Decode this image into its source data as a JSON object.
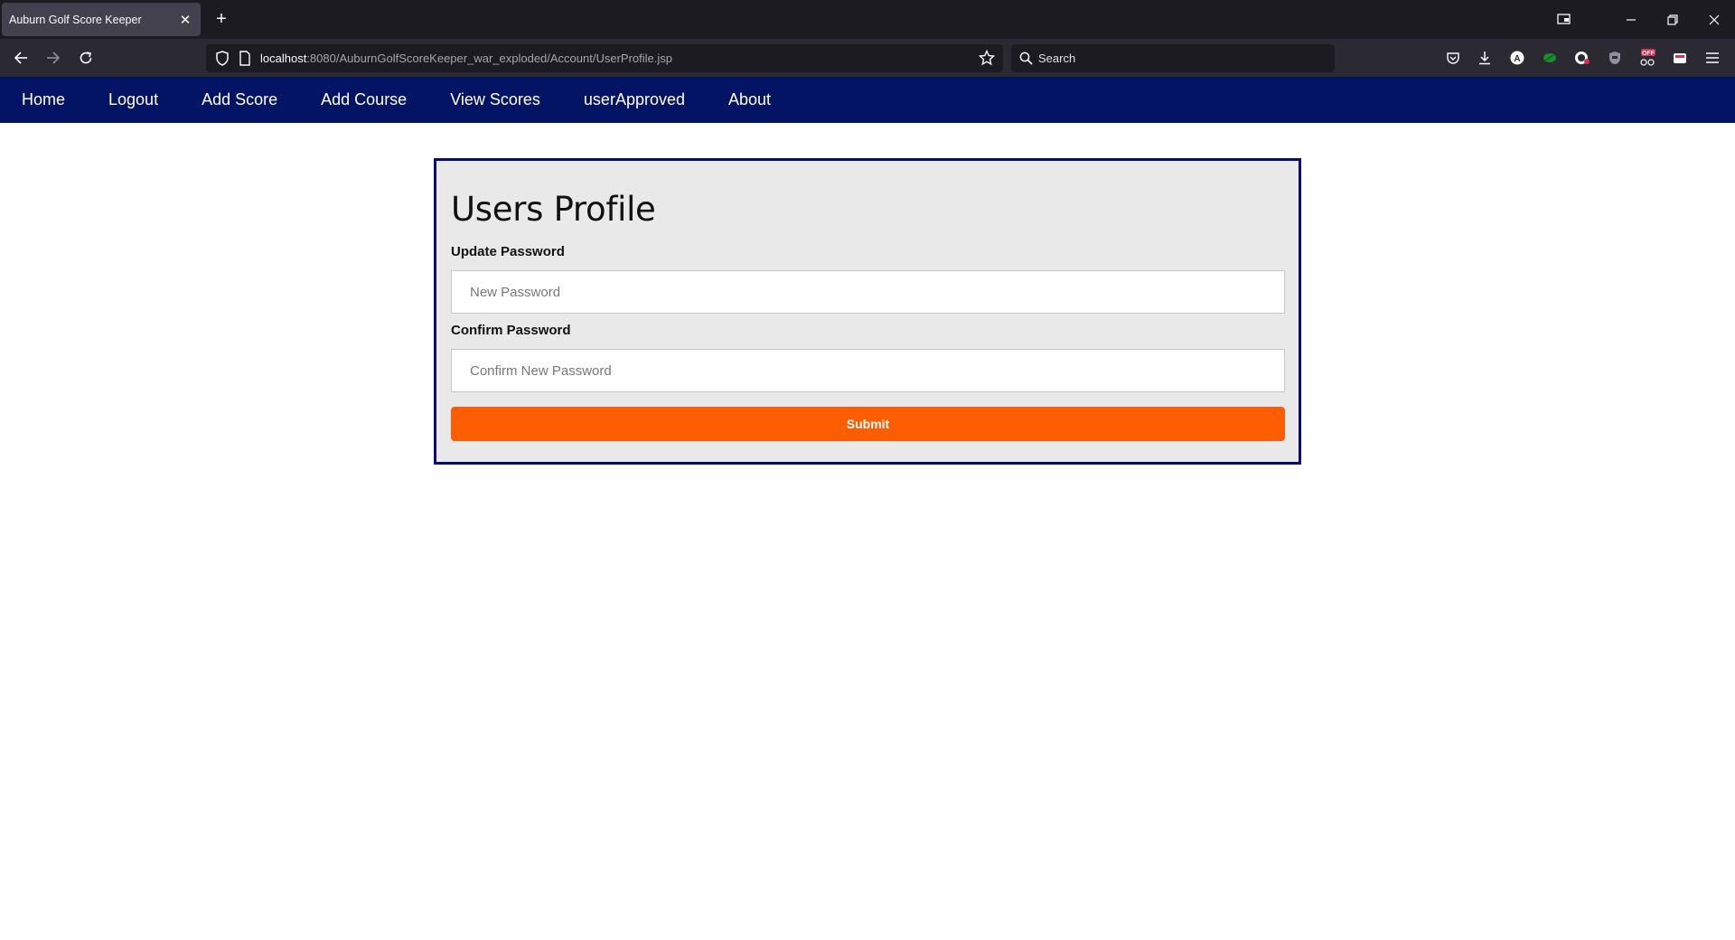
{
  "browser": {
    "tab_title": "Auburn Golf Score Keeper",
    "url_host": "localhost",
    "url_rest": ":8080/AuburnGolfScoreKeeper_war_exploded/Account/UserProfile.jsp",
    "search_placeholder": "Search",
    "ext_badge": "OFF"
  },
  "nav": {
    "items": [
      {
        "label": "Home"
      },
      {
        "label": "Logout"
      },
      {
        "label": "Add Score"
      },
      {
        "label": "Add Course"
      },
      {
        "label": "View Scores"
      },
      {
        "label": "userApproved"
      },
      {
        "label": "About"
      }
    ]
  },
  "profile": {
    "title": "Users Profile",
    "update_password_label": "Update Password",
    "new_password_placeholder": "New Password",
    "confirm_password_label": "Confirm Password",
    "confirm_password_placeholder": "Confirm New Password",
    "submit_label": "Submit"
  },
  "colors": {
    "nav_background": "#041465",
    "box_border": "#0a0b7a",
    "submit_background": "#ff5d01"
  }
}
